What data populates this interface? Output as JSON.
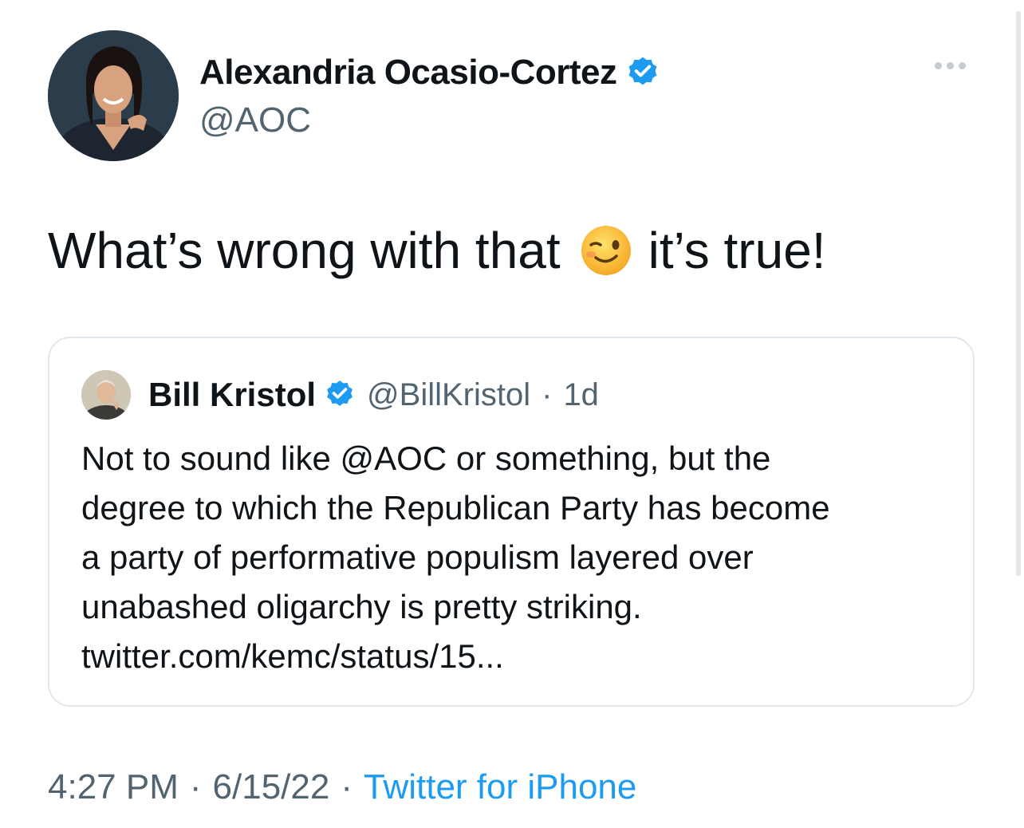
{
  "author": {
    "name": "Alexandria Ocasio-Cortez",
    "handle": "@AOC",
    "avatar_icon": "profile-photo-woman",
    "verified_icon": "verified-badge-icon"
  },
  "tweet": {
    "text_before": "What’s wrong with that",
    "emoji": "winking-face-emoji",
    "text_after": "it’s true!"
  },
  "quoted_tweet": {
    "name": "Bill Kristol",
    "handle": "@BillKristol",
    "separator": "·",
    "age": "1d",
    "avatar_icon": "profile-photo-man",
    "lines": [
      "Not to sound like @AOC or something, but the",
      "degree to which the Republican Party has become",
      "a party of performative populism layered over",
      "unabashed oligarchy is pretty striking.",
      "twitter.com/kemc/status/15..."
    ]
  },
  "footer": {
    "time": "4:27 PM",
    "sep1": "·",
    "date": "6/15/22",
    "sep2": "·",
    "source": "Twitter for iPhone"
  },
  "colors": {
    "verified": "#1d9bf0",
    "link": "#1d9bf0",
    "secondary_text": "#536471",
    "border": "#e1e8ed"
  },
  "menu": {
    "icon": "more-options-icon"
  }
}
